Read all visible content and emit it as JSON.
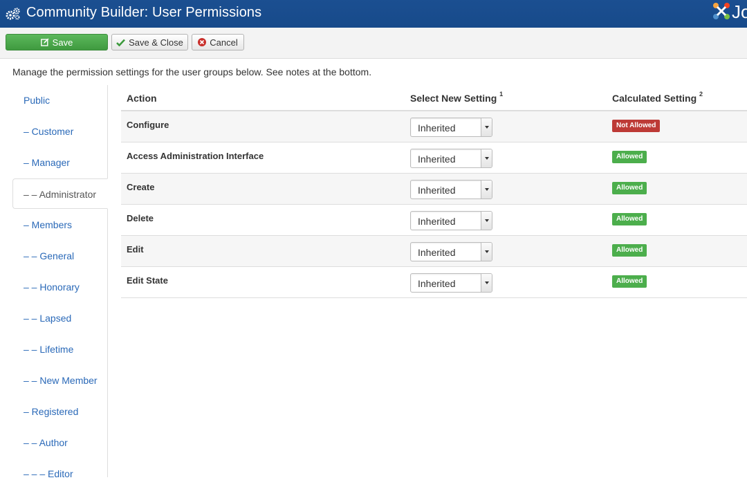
{
  "header": {
    "title": "Community Builder: User Permissions",
    "logo_text": "Jo",
    "icon": "gears-icon"
  },
  "toolbar": {
    "save_label": "Save",
    "save_close_label": "Save & Close",
    "cancel_label": "Cancel"
  },
  "intro": "Manage the permission settings for the user groups below. See notes at the bottom.",
  "sidebar": {
    "items": [
      {
        "label": "Public"
      },
      {
        "label": "– Customer"
      },
      {
        "label": "– Manager"
      },
      {
        "label": "– – Administrator",
        "active": true
      },
      {
        "label": "– Members"
      },
      {
        "label": "– – General"
      },
      {
        "label": "– – Honorary"
      },
      {
        "label": "– – Lapsed"
      },
      {
        "label": "– – Lifetime"
      },
      {
        "label": "– – New Member"
      },
      {
        "label": "– Registered"
      },
      {
        "label": "– – Author"
      },
      {
        "label": "– – – Editor"
      }
    ]
  },
  "table": {
    "headers": {
      "action": "Action",
      "select": "Select New Setting",
      "select_note": "1",
      "calculated": "Calculated Setting",
      "calculated_note": "2"
    },
    "rows": [
      {
        "action": "Configure",
        "setting": "Inherited",
        "calculated": "Not Allowed",
        "status": "denied"
      },
      {
        "action": "Access Administration Interface",
        "setting": "Inherited",
        "calculated": "Allowed",
        "status": "allowed"
      },
      {
        "action": "Create",
        "setting": "Inherited",
        "calculated": "Allowed",
        "status": "allowed"
      },
      {
        "action": "Delete",
        "setting": "Inherited",
        "calculated": "Allowed",
        "status": "allowed"
      },
      {
        "action": "Edit",
        "setting": "Inherited",
        "calculated": "Allowed",
        "status": "allowed"
      },
      {
        "action": "Edit State",
        "setting": "Inherited",
        "calculated": "Allowed",
        "status": "allowed"
      }
    ]
  },
  "colors": {
    "header_bg": "#174a8a",
    "link": "#2a69b8",
    "allowed": "#4cae4c",
    "not_allowed": "#bd3a36",
    "save_button": "#4cae4c"
  }
}
